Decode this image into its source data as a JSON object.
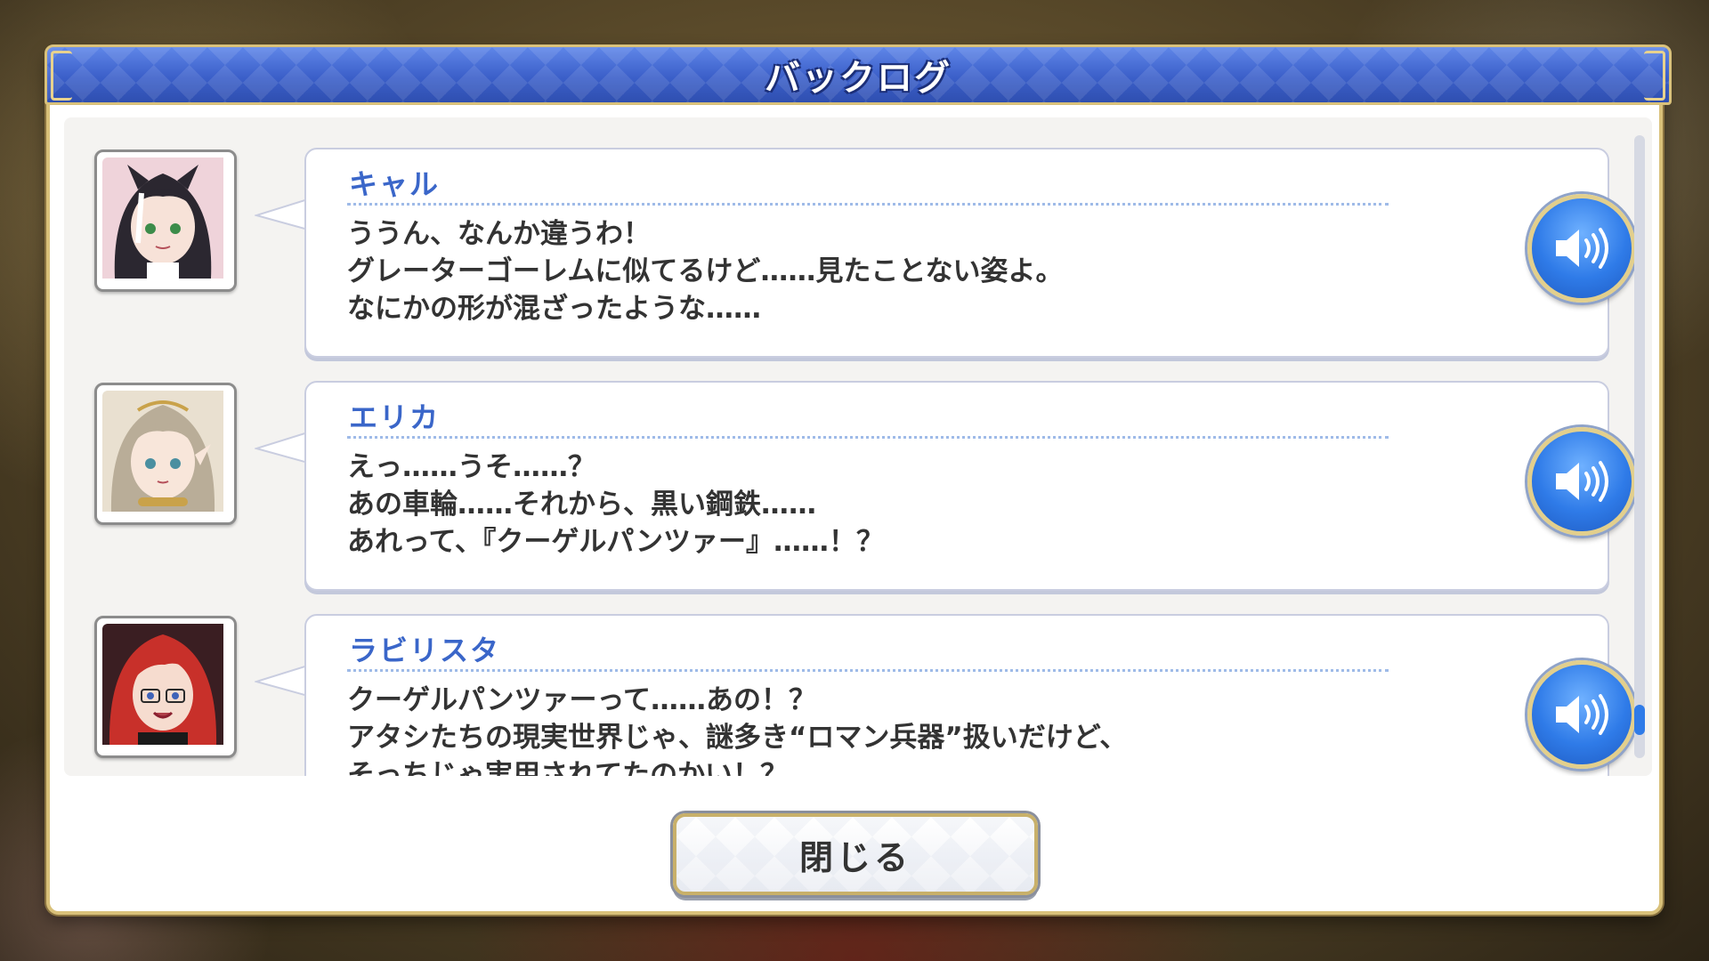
{
  "dialog": {
    "title": "バックログ"
  },
  "entries": [
    {
      "speaker": "キャル",
      "portrait_icon": "character-portrait-kyaru",
      "lines": [
        "ううん、なんか違うわ！",
        "グレーターゴーレムに似てるけど……見たことない姿よ。",
        "なにかの形が混ざったような……"
      ]
    },
    {
      "speaker": "エリカ",
      "portrait_icon": "character-portrait-erika",
      "lines": [
        "えっ……うそ……？",
        "あの車輪……それから、黒い鋼鉄……",
        "あれって、『クーゲルパンツァー』……！？"
      ]
    },
    {
      "speaker": "ラビリスタ",
      "portrait_icon": "character-portrait-labyrista",
      "lines": [
        "クーゲルパンツァーって……あの！？",
        "アタシたちの現実世界じゃ、謎多き“ロマン兵器”扱いだけど、",
        "そっちじゃ実用されてたのかい！？"
      ]
    }
  ],
  "buttons": {
    "close_label": "閉じる",
    "voice_icon": "speaker-volume-icon"
  },
  "colors": {
    "title_bar": "#3b5fc9",
    "speaker_name": "#3a66c9",
    "voice_button": "#2f7be8",
    "frame_gold": "#d9c17a"
  }
}
